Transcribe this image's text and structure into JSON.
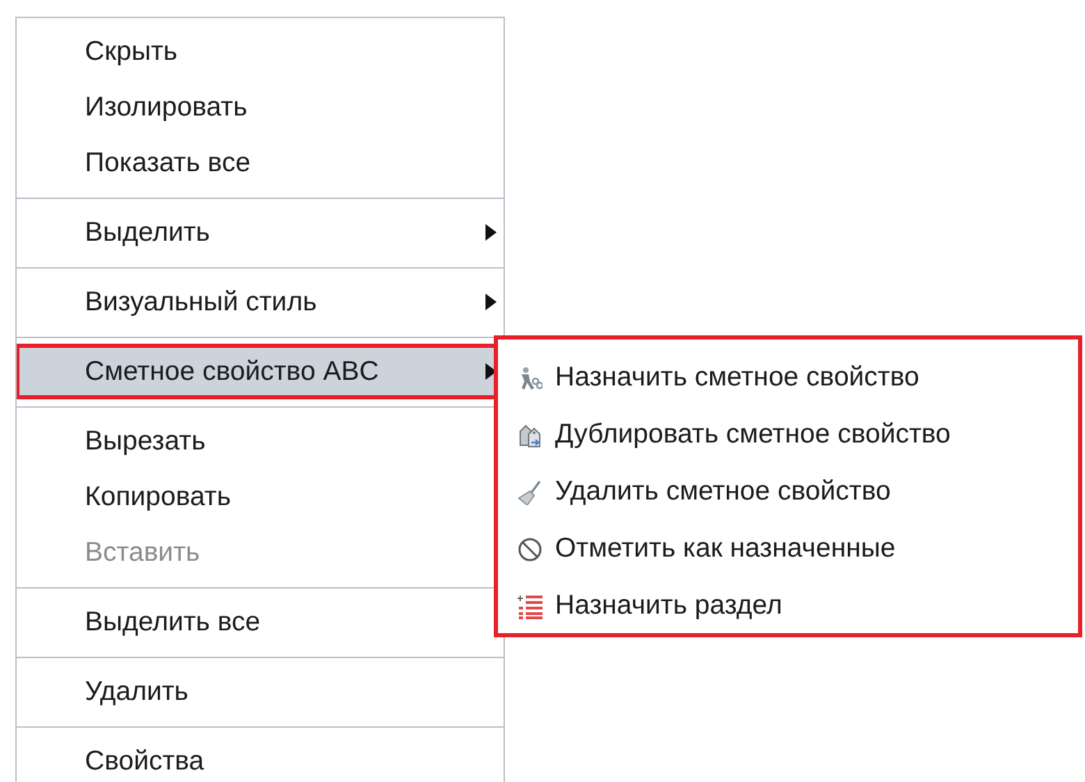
{
  "context_menu": {
    "groups": [
      {
        "items": [
          {
            "label": "Скрыть",
            "disabled": false,
            "has_submenu": false,
            "selected": false
          },
          {
            "label": "Изолировать",
            "disabled": false,
            "has_submenu": false,
            "selected": false
          },
          {
            "label": "Показать все",
            "disabled": false,
            "has_submenu": false,
            "selected": false
          }
        ]
      },
      {
        "items": [
          {
            "label": "Выделить",
            "disabled": false,
            "has_submenu": true,
            "selected": false
          }
        ]
      },
      {
        "items": [
          {
            "label": "Визуальный стиль",
            "disabled": false,
            "has_submenu": true,
            "selected": false
          }
        ]
      },
      {
        "items": [
          {
            "label": "Сметное свойство ABC",
            "disabled": false,
            "has_submenu": true,
            "selected": true
          }
        ]
      },
      {
        "items": [
          {
            "label": "Вырезать",
            "disabled": false,
            "has_submenu": false,
            "selected": false
          },
          {
            "label": "Копировать",
            "disabled": false,
            "has_submenu": false,
            "selected": false
          },
          {
            "label": "Вставить",
            "disabled": true,
            "has_submenu": false,
            "selected": false
          }
        ]
      },
      {
        "items": [
          {
            "label": "Выделить все",
            "disabled": false,
            "has_submenu": false,
            "selected": false
          }
        ]
      },
      {
        "items": [
          {
            "label": "Удалить",
            "disabled": false,
            "has_submenu": false,
            "selected": false
          }
        ]
      },
      {
        "items": [
          {
            "label": "Свойства",
            "disabled": false,
            "has_submenu": false,
            "selected": false
          }
        ]
      }
    ]
  },
  "submenu": {
    "items": [
      {
        "label": "Назначить сметное свойство"
      },
      {
        "label": "Дублировать сметное свойство"
      },
      {
        "label": "Удалить сметное свойство"
      },
      {
        "label": "Отметить как назначенные"
      },
      {
        "label": "Назначить раздел"
      }
    ]
  }
}
